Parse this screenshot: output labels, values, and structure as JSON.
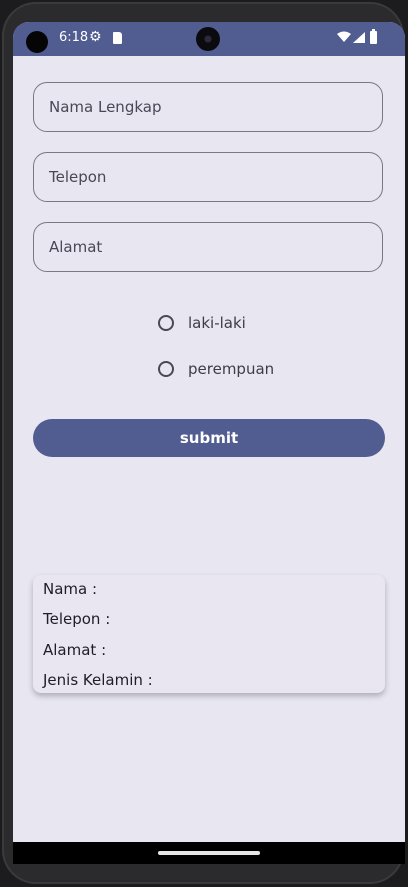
{
  "status_bar": {
    "time": "6:18",
    "icons": [
      "gear-icon",
      "sdcard-icon",
      "wifi-icon",
      "signal-icon",
      "battery-icon"
    ]
  },
  "form": {
    "nama_placeholder": "Nama Lengkap",
    "telepon_placeholder": "Telepon",
    "alamat_placeholder": "Alamat",
    "gender_options": [
      "laki-laki",
      "perempuan"
    ],
    "submit_label": "submit"
  },
  "result": {
    "nama": "Nama :",
    "telepon": "Telepon :",
    "alamat": "Alamat :",
    "jenis_kelamin": "Jenis Kelamin :"
  },
  "colors": {
    "primary": "#515c91",
    "background": "#e8e6f0"
  }
}
